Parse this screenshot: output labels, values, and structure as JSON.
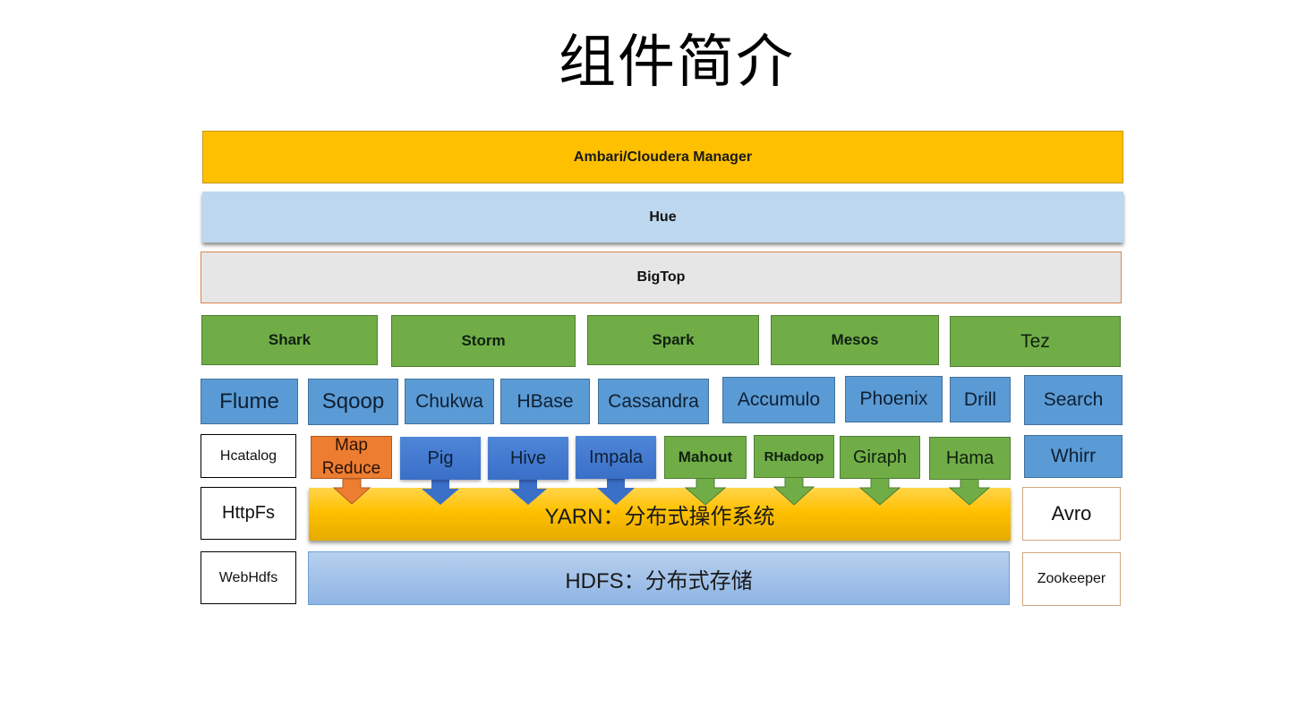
{
  "title": "组件简介",
  "colors": {
    "management": "#ffc000",
    "ui": "#bdd7ee",
    "packaging": "#e6e6e6",
    "compute_engines": "#70ad47",
    "data_services": "#5b9bd5",
    "yarn": "#ffc000",
    "hdfs": "#9dc3e6",
    "mapreduce": "#ed7d31",
    "yarn_apps_blue": "#4472c4"
  },
  "layers": {
    "management": "Ambari/Cloudera Manager",
    "ui": "Hue",
    "packaging": "BigTop"
  },
  "engines": [
    "Shark",
    "Storm",
    "Spark",
    "Mesos",
    "Tez"
  ],
  "data_services": [
    "Flume",
    "Sqoop",
    "Chukwa",
    "HBase",
    "Cassandra",
    "Accumulo",
    "Phoenix",
    "Drill",
    "Search"
  ],
  "left_column": [
    "Hcatalog",
    "HttpFs",
    "WebHdfs"
  ],
  "right_column": [
    "Whirr",
    "Avro",
    "Zookeeper"
  ],
  "yarn_apps": {
    "mapreduce": "Map\nReduce",
    "blue": [
      "Pig",
      "Hive",
      "Impala"
    ],
    "green": [
      "Mahout",
      "RHadoop",
      "Giraph",
      "Hama"
    ]
  },
  "yarn": "YARN：分布式操作系统",
  "hdfs": "HDFS：分布式存储"
}
